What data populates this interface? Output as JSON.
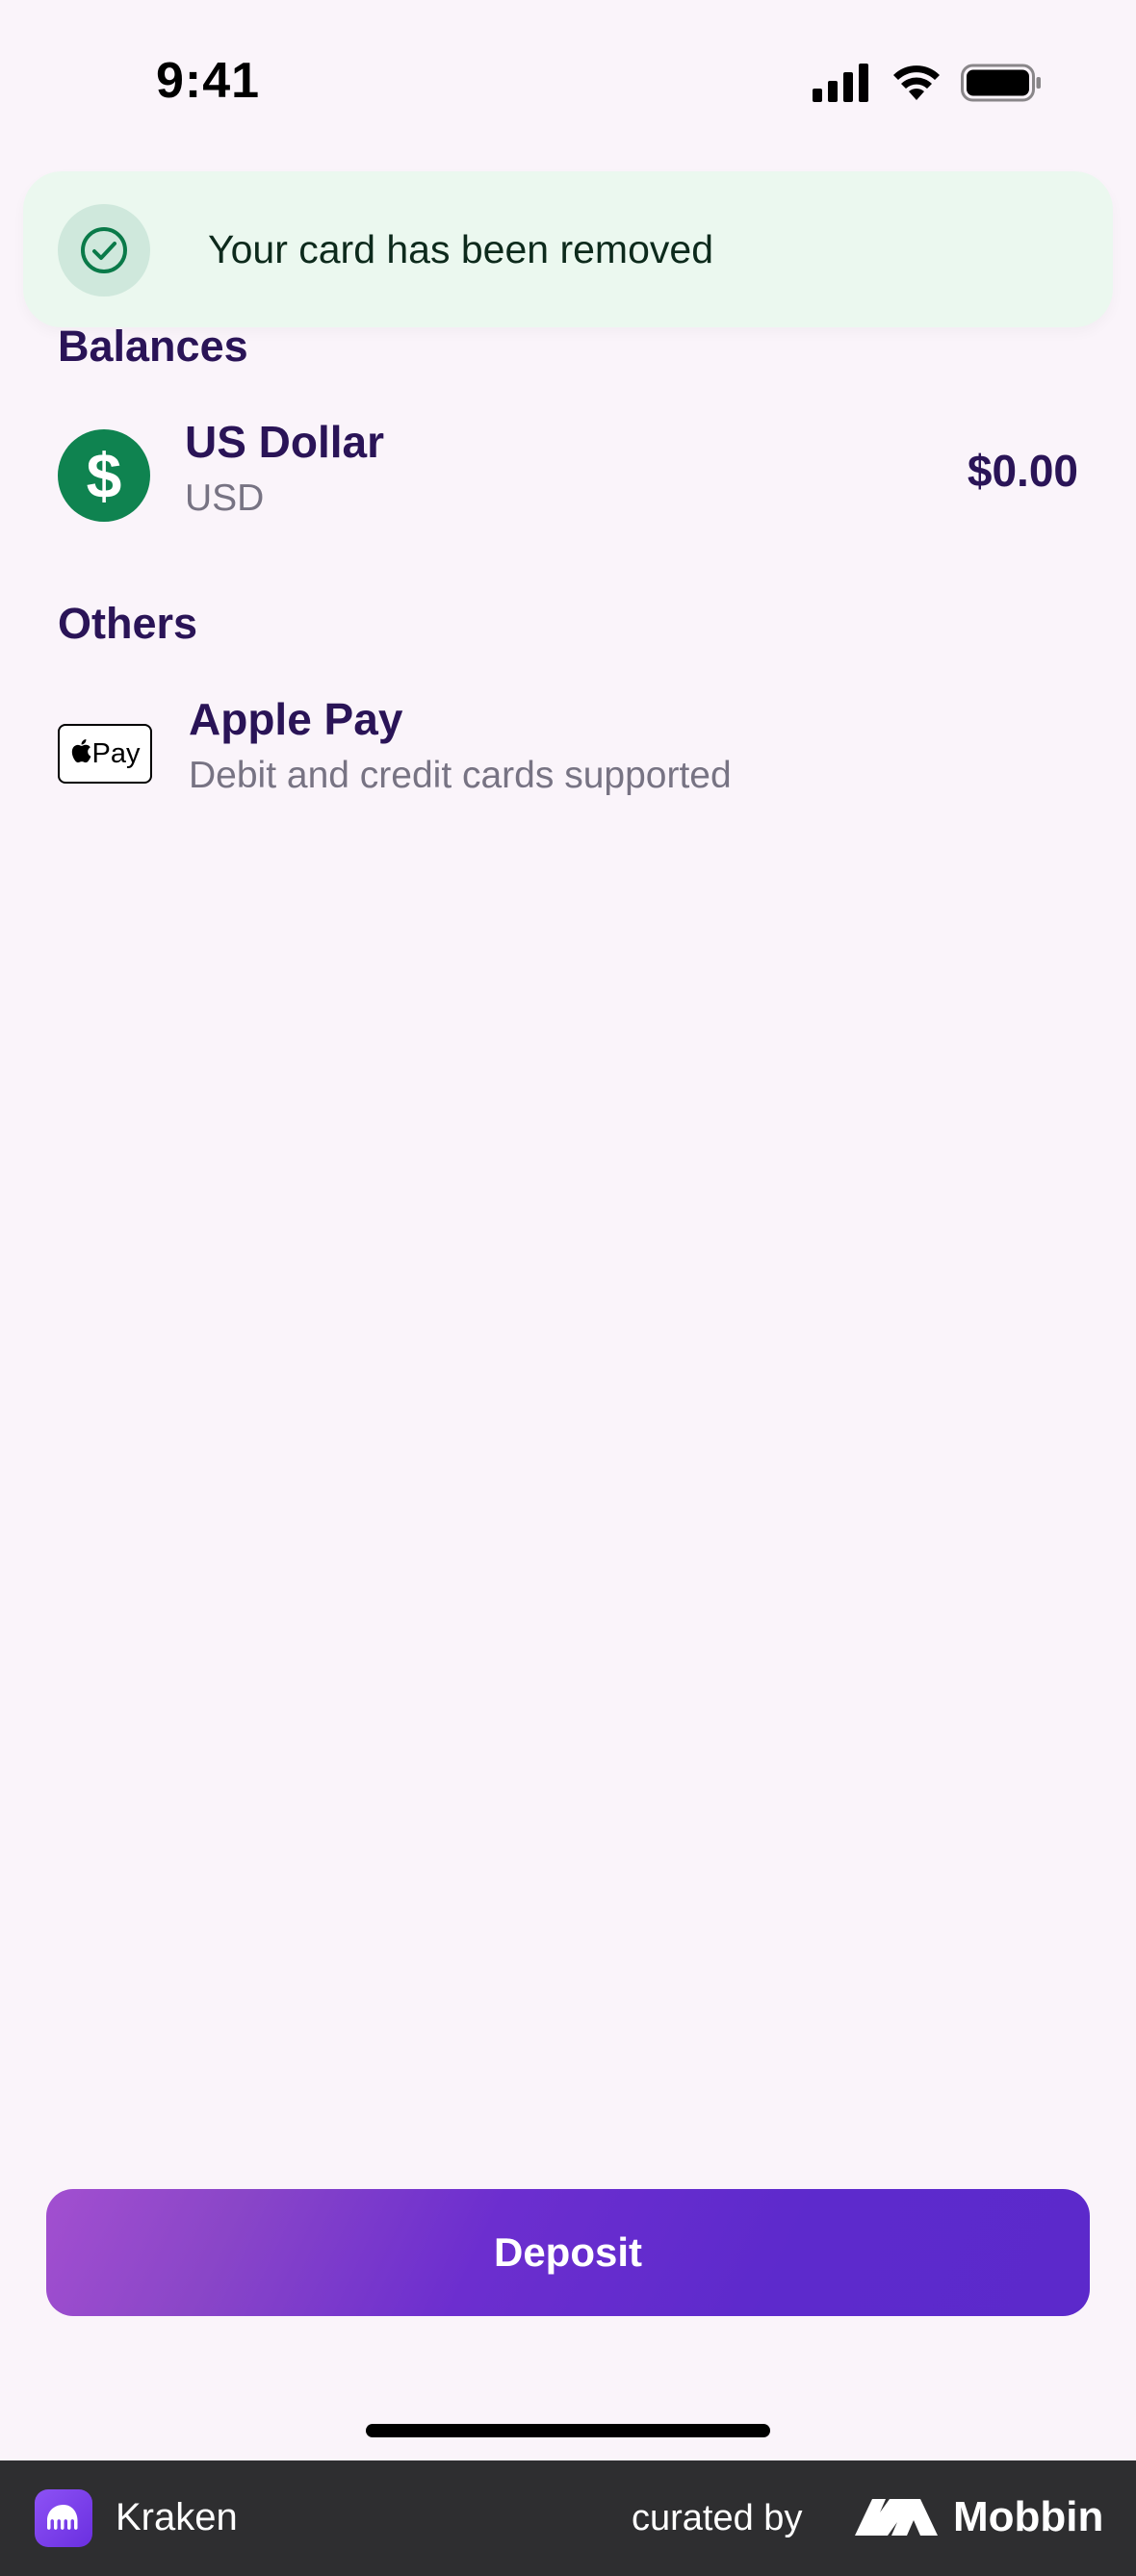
{
  "status_bar": {
    "time": "9:41"
  },
  "toast": {
    "message": "Your card has been removed"
  },
  "balances": {
    "title": "Balances",
    "items": [
      {
        "name": "US Dollar",
        "code": "USD",
        "amount": "$0.00",
        "symbol": "$"
      }
    ]
  },
  "others": {
    "title": "Others",
    "items": [
      {
        "name": "Apple Pay",
        "description": "Debit and credit cards supported",
        "badge": "Pay"
      }
    ]
  },
  "deposit": {
    "label": "Deposit"
  },
  "footer": {
    "app_name": "Kraken",
    "curated_by": "curated by",
    "brand": "Mobbin"
  },
  "colors": {
    "background": "#faf4fa",
    "primary_text": "#2a1457",
    "usd_green": "#0f8350",
    "toast_bg": "#ebf8ef",
    "deposit_start": "#a24fd0",
    "deposit_end": "#5c29cb"
  }
}
